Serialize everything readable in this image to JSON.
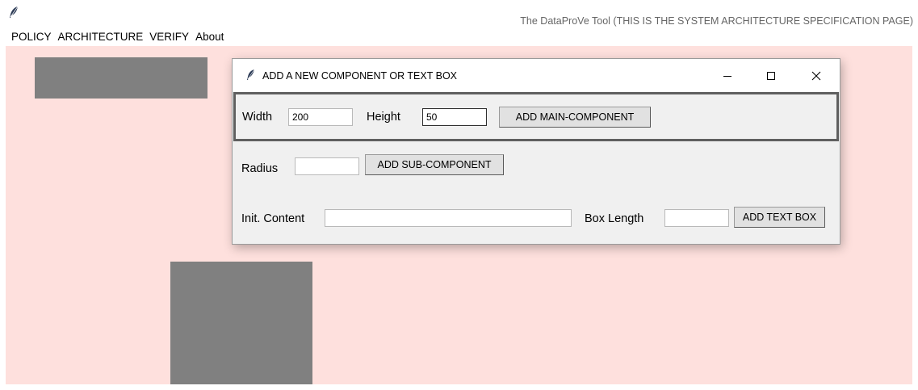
{
  "window": {
    "title": "The DataProVe Tool (THIS IS THE SYSTEM ARCHITECTURE SPECIFICATION PAGE)",
    "icon": "feather-icon"
  },
  "menu": {
    "items": [
      "POLICY",
      "ARCHITECTURE",
      "VERIFY",
      "About"
    ]
  },
  "dialog": {
    "title": "ADD A NEW COMPONENT OR TEXT BOX",
    "icon": "feather-icon",
    "controls": [
      "minimize-icon",
      "maximize-icon",
      "close-icon"
    ],
    "main_component": {
      "width_label": "Width",
      "width_value": "200",
      "height_label": "Height",
      "height_value": "50",
      "button_label": "ADD MAIN-COMPONENT"
    },
    "sub_component": {
      "radius_label": "Radius",
      "radius_value": "",
      "button_label": "ADD SUB-COMPONENT"
    },
    "text_box": {
      "content_label": "Init. Content",
      "content_value": "",
      "length_label": "Box Length",
      "length_value": "",
      "button_label": "ADD TEXT BOX"
    }
  },
  "colors": {
    "canvas_background": "#fee0dd",
    "component_fill": "#808080",
    "title_text": "#666666"
  }
}
